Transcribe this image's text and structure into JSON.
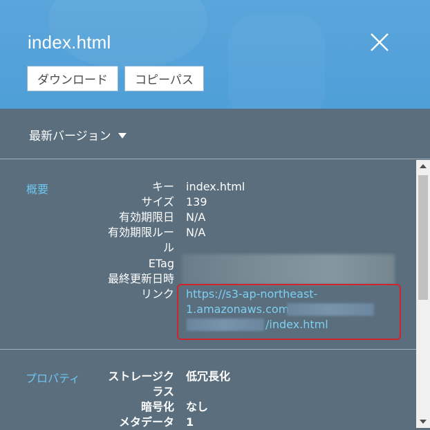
{
  "header": {
    "title": "index.html",
    "download_label": "ダウンロード",
    "copy_path_label": "コピーパス"
  },
  "version": {
    "label": "最新バージョン"
  },
  "overview": {
    "section_label": "概要",
    "key_label": "キー",
    "key_value": "index.html",
    "size_label": "サイズ",
    "size_value": "139",
    "expiry_date_label": "有効期限日",
    "expiry_date_value": "N/A",
    "expiry_rule_label_1": "有効期限ルー",
    "expiry_rule_label_2": "ル",
    "expiry_rule_value": "N/A",
    "etag_label": "ETag",
    "last_modified_label": "最終更新日時",
    "link_label": "リンク",
    "link_line1": "https://s3-ap-northeast-",
    "link_line2": "1.amazonaws.com/",
    "link_line3": "/index.html"
  },
  "properties": {
    "section_label": "プロパティ",
    "storage_class_label_1": "ストレージク",
    "storage_class_label_2": "ラス",
    "storage_class_value": "低冗長化",
    "encryption_label": "暗号化",
    "encryption_value": "なし",
    "metadata_label": "メタデータ",
    "metadata_value": "1"
  },
  "colors": {
    "header_bg": "#5aa5db",
    "panel_bg": "#5a6e7d",
    "accent_link": "#7dd0f3",
    "highlight": "#d0232a"
  }
}
